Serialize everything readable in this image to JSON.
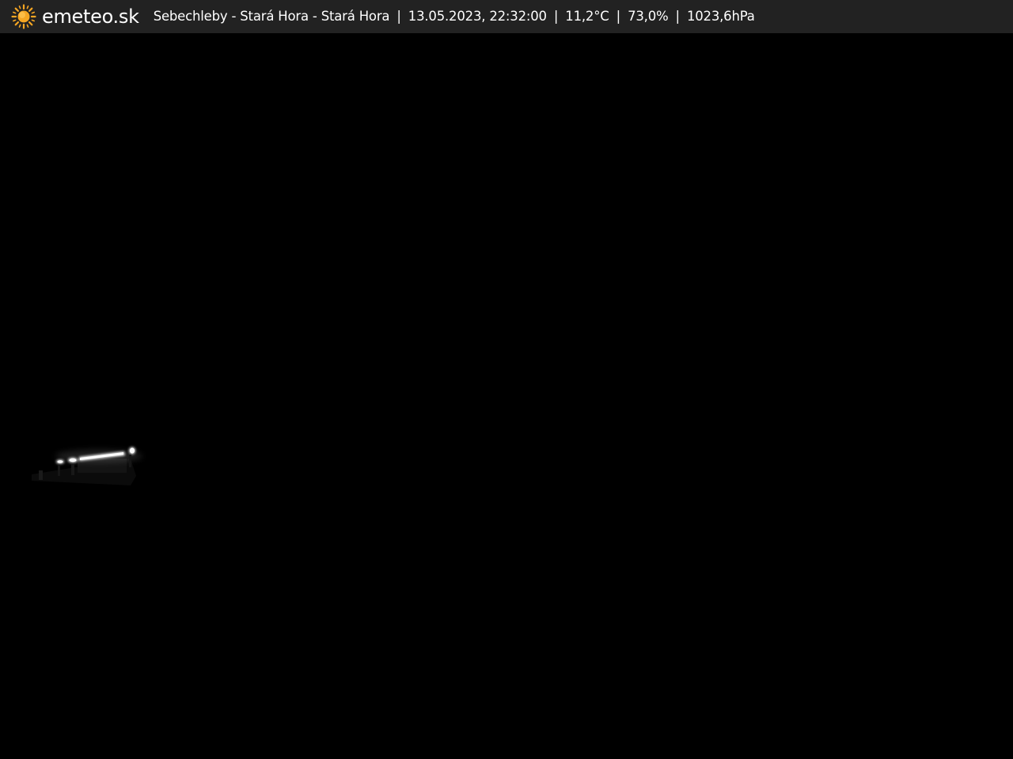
{
  "header": {
    "logo": {
      "text": "emeteo.sk",
      "icon": "sun-icon",
      "icon_color": "#f5a623"
    },
    "station_name": "Sebechleby - Stará Hora - Stará Hora",
    "datetime": "13.05.2023, 22:32:00",
    "temperature": "11,2°C",
    "humidity": "73,0%",
    "pressure": "1023,6hPa",
    "separator": "|",
    "background_color": "#222222"
  },
  "webcam": {
    "scene": "night-view",
    "background_color": "#000000",
    "light_color": "#ffffff"
  }
}
